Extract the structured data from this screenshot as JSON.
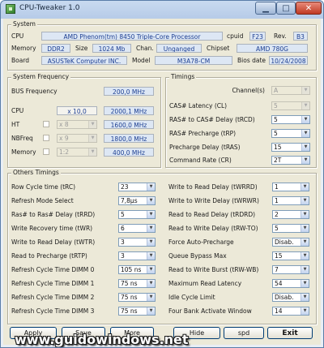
{
  "window": {
    "title": "CPU-Tweaker 1.0",
    "minimize_glyph": "▁",
    "maximize_glyph": "□",
    "close_glyph": "✕"
  },
  "system": {
    "legend": "System",
    "cpu_label": "CPU",
    "cpu_value": "AMD Phenom(tm) 8450 Triple-Core Processor",
    "cpuid_label": "cpuid",
    "cpuid_value": "F23",
    "rev_label": "Rev.",
    "rev_value": "B3",
    "memory_label": "Memory",
    "memory_value": "DDR2",
    "size_label": "Size",
    "size_value": "1024 Mb",
    "chan_label": "Chan.",
    "chan_value": "Unganged",
    "chipset_label": "Chipset",
    "chipset_value": "AMD 780G",
    "board_label": "Board",
    "board_value": "ASUSTeK Computer INC.",
    "model_label": "Model",
    "model_value": "M3A78-CM",
    "bios_label": "Bios date",
    "bios_value": "10/24/2008"
  },
  "frequency": {
    "legend": "System Frequency",
    "bus_label": "BUS Frequency",
    "bus_value": "200,0 MHz",
    "rows": [
      {
        "label": "CPU",
        "mult": "x 10,0",
        "value": "2000,1 MHz"
      },
      {
        "label": "HT",
        "mult": "x 8",
        "value": "1600,0 MHz"
      },
      {
        "label": "NBFreq",
        "mult": "x 9",
        "value": "1800,0 MHz"
      },
      {
        "label": "Memory",
        "mult": "1:2",
        "value": "400,0 MHz"
      }
    ]
  },
  "timings": {
    "legend": "Timings",
    "channels_label": "Channel(s)",
    "channels_value": "A",
    "rows": [
      {
        "label": "CAS# Latency (CL)",
        "value": "5"
      },
      {
        "label": "RAS# to CAS# Delay (tRCD)",
        "value": "5"
      },
      {
        "label": "RAS# Precharge (tRP)",
        "value": "5"
      },
      {
        "label": "Precharge Delay (tRAS)",
        "value": "15"
      },
      {
        "label": "Command Rate (CR)",
        "value": "2T"
      }
    ]
  },
  "others": {
    "legend": "Others Timings",
    "left": [
      {
        "label": "Row Cycle time (tRC)",
        "value": "23"
      },
      {
        "label": "Refresh Mode Select",
        "value": "7,8µs"
      },
      {
        "label": "Ras# to Ras# Delay (tRRD)",
        "value": "5"
      },
      {
        "label": "Write Recovery time (tWR)",
        "value": "6"
      },
      {
        "label": "Write to Read Delay (tWTR)",
        "value": "3"
      },
      {
        "label": "Read to Precharge (tRTP)",
        "value": "3"
      },
      {
        "label": "Refresh Cycle Time  DIMM 0",
        "value": "105 ns"
      },
      {
        "label": "Refresh Cycle Time  DIMM 1",
        "value": "75 ns"
      },
      {
        "label": "Refresh Cycle Time  DIMM 2",
        "value": "75 ns"
      },
      {
        "label": "Refresh Cycle Time  DIMM 3",
        "value": "75 ns"
      }
    ],
    "right": [
      {
        "label": "Write to Read Delay (tWRRD)",
        "value": "1"
      },
      {
        "label": "Write to Write Delay (tWRWR)",
        "value": "1"
      },
      {
        "label": "Read to Read Delay (tRDRD)",
        "value": "2"
      },
      {
        "label": "Read to Write Delay (tRW-TO)",
        "value": "5"
      },
      {
        "label": "Force Auto-Precharge",
        "value": "Disab."
      },
      {
        "label": "Queue Bypass Max",
        "value": "15"
      },
      {
        "label": "Read to Write Burst  (tRW-WB)",
        "value": "7"
      },
      {
        "label": "Maximum Read Latency",
        "value": "54"
      },
      {
        "label": "Idle Cycle Limit",
        "value": "Disab."
      },
      {
        "label": "Four Bank Activate Window",
        "value": "14"
      }
    ]
  },
  "buttons": {
    "apply": "Apply",
    "save": "Save",
    "more": "More",
    "hide": "Hide",
    "spd": "spd",
    "exit": "Exit"
  },
  "watermark": "www.guidowindows.net",
  "icons": {
    "app": "chip-icon",
    "dropdown": "chevron-down-icon"
  },
  "colors": {
    "value_text": "#1d3f92",
    "value_bg": "#dde7f4",
    "window_face": "#ece9d8"
  }
}
